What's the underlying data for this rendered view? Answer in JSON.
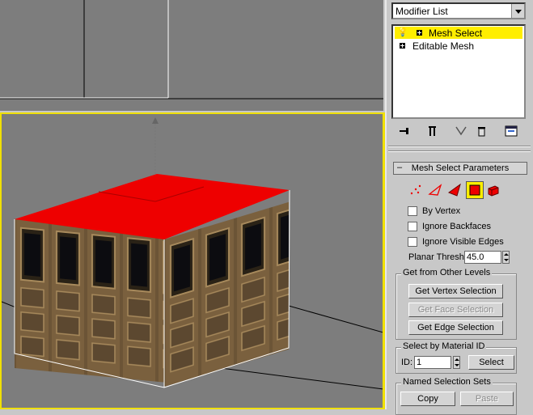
{
  "modifier_list": {
    "label": "Modifier List"
  },
  "stack": {
    "items": [
      {
        "label": "Mesh Select",
        "selected": true
      },
      {
        "label": "Editable Mesh",
        "selected": false
      }
    ]
  },
  "stack_toolbar": {
    "icons": [
      "pin-stack-icon",
      "show-end-result-icon",
      "make-unique-icon",
      "remove-modifier-icon",
      "configure-sets-icon"
    ]
  },
  "rollout": {
    "title": "Mesh Select Parameters",
    "collapse_symbol": "–",
    "selection_levels": [
      "vertex-level-icon",
      "edge-level-icon",
      "face-level-icon",
      "polygon-level-icon",
      "element-level-icon"
    ],
    "active_level": "polygon",
    "by_vertex": "By Vertex",
    "ignore_backfaces": "Ignore Backfaces",
    "ignore_visible_edges": "Ignore Visible Edges",
    "planar_thresh_label": "Planar Thresh:",
    "planar_thresh_value": "45.0"
  },
  "get_from_levels": {
    "title": "Get from Other Levels",
    "vertex_btn": "Get Vertex Selection",
    "face_btn": "Get Face Selection",
    "edge_btn": "Get Edge Selection"
  },
  "material_id": {
    "title": "Select by Material ID",
    "id_label": "ID:",
    "id_value": "1",
    "select_btn": "Select"
  },
  "named_sets": {
    "title": "Named Selection Sets",
    "copy_btn": "Copy",
    "paste_btn": "Paste"
  },
  "colors": {
    "viewport_bg": "#7d7d7d",
    "active_border": "#f0e000",
    "selected_face": "#ee0000",
    "stack_highlight": "#ffee00"
  }
}
